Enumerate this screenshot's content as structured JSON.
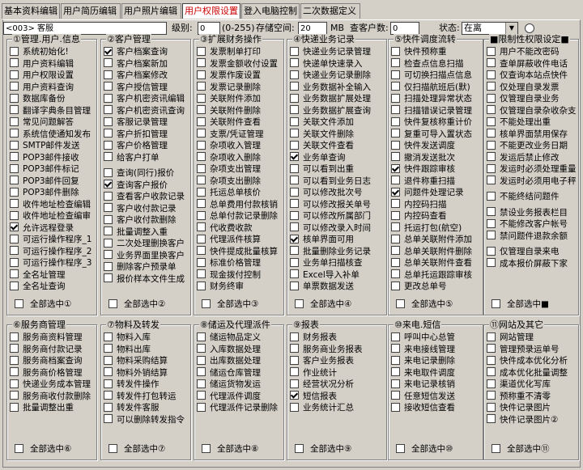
{
  "tabs": [
    "基本资料编辑",
    "用户简历编辑",
    "用户照片编辑",
    "用户权限设置",
    "登入电脑控制",
    "二次数据定义"
  ],
  "toprow": {
    "user_value": "<003> 客服",
    "level_label": "级别:",
    "level_value": "0",
    "level_range": "(0-255)",
    "storage_label": "存储空间:",
    "storage_value": "20",
    "storage_unit": "MB",
    "clients_label": "查客户数:",
    "clients_value": "0",
    "status_label": "状态:",
    "status_value": "在离"
  },
  "groups": [
    {
      "title": "①管理.用户.信息",
      "items": [
        {
          "label": "系统初始化!",
          "checked": false
        },
        {
          "label": "用户资料编辑",
          "checked": false
        },
        {
          "label": "用户权限设置",
          "checked": false
        },
        {
          "label": "用户资料查询",
          "checked": false
        },
        {
          "label": "数据库备份",
          "checked": false
        },
        {
          "label": "翻译字典条目管理",
          "checked": false
        },
        {
          "label": "常见问题解答",
          "checked": false
        },
        {
          "label": "系统信使通知发布",
          "checked": false
        },
        {
          "label": "SMTP邮件发送",
          "checked": false
        },
        {
          "label": "POP3邮件接收",
          "checked": false
        },
        {
          "label": "POP3邮件标记",
          "checked": false
        },
        {
          "label": "POP3邮件回复",
          "checked": false
        },
        {
          "label": "POP3邮件删除",
          "checked": false
        },
        {
          "label": "收件地址检查编辑",
          "checked": false
        },
        {
          "label": "收件地址检查编审",
          "checked": false
        },
        {
          "label": "允许远程登录",
          "checked": true
        },
        {
          "label": "可运行操作程序_1",
          "checked": false
        },
        {
          "label": "可运行操作程序_2",
          "checked": false
        },
        {
          "label": "可运行操作程序_3",
          "checked": false
        },
        {
          "label": "全名址管理",
          "checked": false
        },
        {
          "label": "全名址查询",
          "checked": false
        }
      ],
      "select_all": "全部选中①"
    },
    {
      "title": "②客户管理",
      "items": [
        {
          "label": "客户档案查询",
          "checked": true
        },
        {
          "label": "客户档案新加",
          "checked": false
        },
        {
          "label": "客户档案修改",
          "checked": false
        },
        {
          "label": "客户授信管理",
          "checked": false
        },
        {
          "label": "客户机密资讯编辑",
          "checked": false
        },
        {
          "label": "客户机密资讯查询",
          "checked": false
        },
        {
          "label": "客服记录管理",
          "checked": false
        },
        {
          "label": "客户折扣管理",
          "checked": false
        },
        {
          "label": "客户价格管理",
          "checked": false
        },
        {
          "label": "给客户打单",
          "checked": false
        },
        {
          "gap": true
        },
        {
          "label": "查询(同行)报价",
          "checked": false
        },
        {
          "label": "查询客户报价",
          "checked": true
        },
        {
          "label": "查看客户收款记录",
          "checked": false
        },
        {
          "label": "客户收付款记录",
          "checked": false
        },
        {
          "label": "客户收付款删除",
          "checked": false
        },
        {
          "label": "批量调整入重",
          "checked": false
        },
        {
          "label": "二次处理删换客户",
          "checked": false
        },
        {
          "label": "业务界面里换客户",
          "checked": false
        },
        {
          "label": "删除客户预录单",
          "checked": false
        },
        {
          "label": "报价样本文件生成",
          "checked": false
        }
      ],
      "select_all": "全部选中②"
    },
    {
      "title": "③扩展财务操作",
      "items": [
        {
          "label": "发票制单打印",
          "checked": false
        },
        {
          "label": "发票金额收付设置",
          "checked": false
        },
        {
          "label": "发票作废设置",
          "checked": false
        },
        {
          "label": "发票记录删除",
          "checked": false
        },
        {
          "label": "关联附件添加",
          "checked": false
        },
        {
          "label": "关联附件删除",
          "checked": false
        },
        {
          "label": "关联附件查看",
          "checked": false
        },
        {
          "label": "支票/凭证管理",
          "checked": false
        },
        {
          "label": "杂项收入管理",
          "checked": false
        },
        {
          "label": "杂项收入删除",
          "checked": false
        },
        {
          "label": "杂项支出管理",
          "checked": false
        },
        {
          "label": "杂项支出删除",
          "checked": false
        },
        {
          "label": "托运总单核价",
          "checked": false
        },
        {
          "label": "总单费用付款核销",
          "checked": false
        },
        {
          "label": "总单付款记录删除",
          "checked": false
        },
        {
          "label": "代收费收款",
          "checked": false
        },
        {
          "label": "代理派件核算",
          "checked": false
        },
        {
          "label": "快件提成批量核算",
          "checked": false
        },
        {
          "label": "标准价格管理",
          "checked": false
        },
        {
          "label": "现金拨付控制",
          "checked": false
        },
        {
          "label": "财务终审",
          "checked": false
        }
      ],
      "select_all": "全部选中③"
    },
    {
      "title": "④快递业务记录",
      "items": [
        {
          "label": "快递业务记录管理",
          "checked": false
        },
        {
          "label": "快递单快速录入",
          "checked": false
        },
        {
          "label": "快递业务记录删除",
          "checked": false
        },
        {
          "label": "业务数据补全输入",
          "checked": false
        },
        {
          "label": "业务数据扩展处理",
          "checked": false
        },
        {
          "label": "业务数据扩展查询",
          "checked": false
        },
        {
          "label": "关联文件添加",
          "checked": false
        },
        {
          "label": "关联文件删除",
          "checked": false
        },
        {
          "label": "关联文件查看",
          "checked": false
        },
        {
          "label": "业务单查询",
          "checked": true
        },
        {
          "label": "可以看到出重",
          "checked": false
        },
        {
          "label": "可以看到业务日志",
          "checked": false
        },
        {
          "label": "可以修改批次号",
          "checked": false
        },
        {
          "label": "可以修改报关单号",
          "checked": false
        },
        {
          "label": "可以修改所属部门",
          "checked": false
        },
        {
          "label": "可以修改录入时间",
          "checked": false
        },
        {
          "label": "核单界面可用",
          "checked": true
        },
        {
          "label": "批量删除业务记录",
          "checked": false
        },
        {
          "label": "业务单扫描核查",
          "checked": false
        },
        {
          "label": "Excel导入补单",
          "checked": false
        },
        {
          "label": "单票数据发送",
          "checked": false
        }
      ],
      "select_all": "全部选中④"
    },
    {
      "title": "⑤快件调度流转",
      "items": [
        {
          "label": "快件预称重",
          "checked": false
        },
        {
          "label": "检查点信息扫描",
          "checked": false
        },
        {
          "label": "可切换扫描点信息",
          "checked": false
        },
        {
          "label": "仅扫描航班后(默)",
          "checked": false
        },
        {
          "label": "扫描处理异常状态",
          "checked": false
        },
        {
          "label": "扫描错误记录管理",
          "checked": false
        },
        {
          "label": "快件复核称重计价",
          "checked": false
        },
        {
          "label": "复重可导入置状态",
          "checked": false
        },
        {
          "label": "快件发送调度",
          "checked": false
        },
        {
          "label": "撤消发送批次",
          "checked": false
        },
        {
          "label": "快件跟踪审核",
          "checked": true
        },
        {
          "label": "退件称重扫描",
          "checked": false
        },
        {
          "label": "问题件处理记录",
          "checked": true
        },
        {
          "label": "内控码扫描",
          "checked": false
        },
        {
          "label": "内控码查看",
          "checked": false
        },
        {
          "label": "托运打包(航空)",
          "checked": false
        },
        {
          "label": "总单关联附件添加",
          "checked": false
        },
        {
          "label": "总单关联附件删除",
          "checked": false
        },
        {
          "label": "总单关联附件查看",
          "checked": false
        },
        {
          "label": "总单托运跟踪审核",
          "checked": false
        },
        {
          "label": "更改总单号",
          "checked": false
        }
      ],
      "select_all": "全部选中⑤"
    },
    {
      "title": "■限制性权限设定■",
      "items": [
        {
          "label": "用户不能改密码",
          "checked": false
        },
        {
          "label": "查单屏蔽收件电话",
          "checked": false
        },
        {
          "label": "仅查询本站点快件",
          "checked": false
        },
        {
          "label": "仅处理自录发票",
          "checked": false
        },
        {
          "label": "仅管理自录业务",
          "checked": false
        },
        {
          "label": "仅管理自录杂收杂支",
          "checked": false
        },
        {
          "label": "不能处理出重",
          "checked": false
        },
        {
          "label": "核单界面禁用保存",
          "checked": false
        },
        {
          "label": "不能更改业务日期",
          "checked": false
        },
        {
          "label": "发运后禁止修改",
          "checked": false
        },
        {
          "label": "发运时必须处理重量",
          "checked": false
        },
        {
          "label": "发运时必须用电子秤",
          "checked": false
        },
        {
          "gap": true
        },
        {
          "label": "不能终结问题件",
          "checked": false
        },
        {
          "gap": true
        },
        {
          "label": "禁设业务报表栏目",
          "checked": false
        },
        {
          "label": "不能修改客户帐号",
          "checked": false
        },
        {
          "label": "禁问题件退款余额",
          "checked": false
        },
        {
          "gap": true
        },
        {
          "label": "仅管理自录来电",
          "checked": false
        },
        {
          "label": "成本报价屏蔽下家",
          "checked": false
        }
      ],
      "select_all": "全部选中■"
    },
    {
      "title": "⑥服务商管理",
      "items": [
        {
          "label": "服务商资料管理",
          "checked": false
        },
        {
          "label": "服务商付款记录",
          "checked": false
        },
        {
          "label": "服务商档案查询",
          "checked": false
        },
        {
          "label": "服务商价格管理",
          "checked": false
        },
        {
          "label": "快递业务成本管理",
          "checked": false
        },
        {
          "label": "服务商收付款删除",
          "checked": false
        },
        {
          "label": "批量调整出重",
          "checked": false
        }
      ],
      "select_all": "全部选中⑥"
    },
    {
      "title": "⑦物料及转发",
      "items": [
        {
          "label": "物料入库",
          "checked": false
        },
        {
          "label": "物料出库",
          "checked": false
        },
        {
          "label": "物料采购结算",
          "checked": false
        },
        {
          "label": "物料外销结算",
          "checked": false
        },
        {
          "label": "转发件操作",
          "checked": false
        },
        {
          "label": "转发件打包转运",
          "checked": false
        },
        {
          "label": "转发件客服",
          "checked": false
        },
        {
          "label": "可以删除转发指令",
          "checked": false
        }
      ],
      "select_all": "全部选中⑦"
    },
    {
      "title": "⑧储运及代理派件",
      "items": [
        {
          "label": "储运物品定义",
          "checked": false
        },
        {
          "label": "入库数据处理",
          "checked": false
        },
        {
          "label": "出库数据处理",
          "checked": false
        },
        {
          "label": "储运仓库管理",
          "checked": false
        },
        {
          "label": "储运货物发运",
          "checked": false
        },
        {
          "label": "代理派件调度",
          "checked": false
        },
        {
          "label": "代理派件记录删除",
          "checked": false
        }
      ],
      "select_all": "全部选中⑧"
    },
    {
      "title": "⑨报表",
      "items": [
        {
          "label": "财务报表",
          "checked": false
        },
        {
          "label": "服务商业务报表",
          "checked": false
        },
        {
          "label": "客户业务报表",
          "checked": false
        },
        {
          "label": "作业统计",
          "checked": false
        },
        {
          "label": "经营状况分析",
          "checked": false
        },
        {
          "label": "短信报表",
          "checked": true
        },
        {
          "label": "业务统计汇总",
          "checked": false
        }
      ],
      "select_all": "全部选中⑨"
    },
    {
      "title": "⑩来电.短信",
      "items": [
        {
          "label": "呼叫中心总管",
          "checked": false
        },
        {
          "label": "来电接线管理",
          "checked": false
        },
        {
          "label": "来电记录删除",
          "checked": false
        },
        {
          "label": "来电取件调度",
          "checked": false
        },
        {
          "label": "来电记录核销",
          "checked": false
        },
        {
          "label": "任意短信发送",
          "checked": false
        },
        {
          "label": "接收短信查看",
          "checked": false
        }
      ],
      "select_all": "全部选中⑩"
    },
    {
      "title": "⑪网站及其它",
      "items": [
        {
          "label": "网站管理",
          "checked": false
        },
        {
          "label": "管理预录运单号",
          "checked": false
        },
        {
          "label": "快件成本优化分析",
          "checked": false
        },
        {
          "label": "成本优化批量调整",
          "checked": false
        },
        {
          "label": "渠道优化写库",
          "checked": false
        },
        {
          "label": "预称重不清零",
          "checked": false
        },
        {
          "label": "快件记录图片",
          "checked": false
        },
        {
          "label": "快件记录图片②",
          "checked": false
        }
      ],
      "select_all": "全部选中⑪"
    }
  ]
}
